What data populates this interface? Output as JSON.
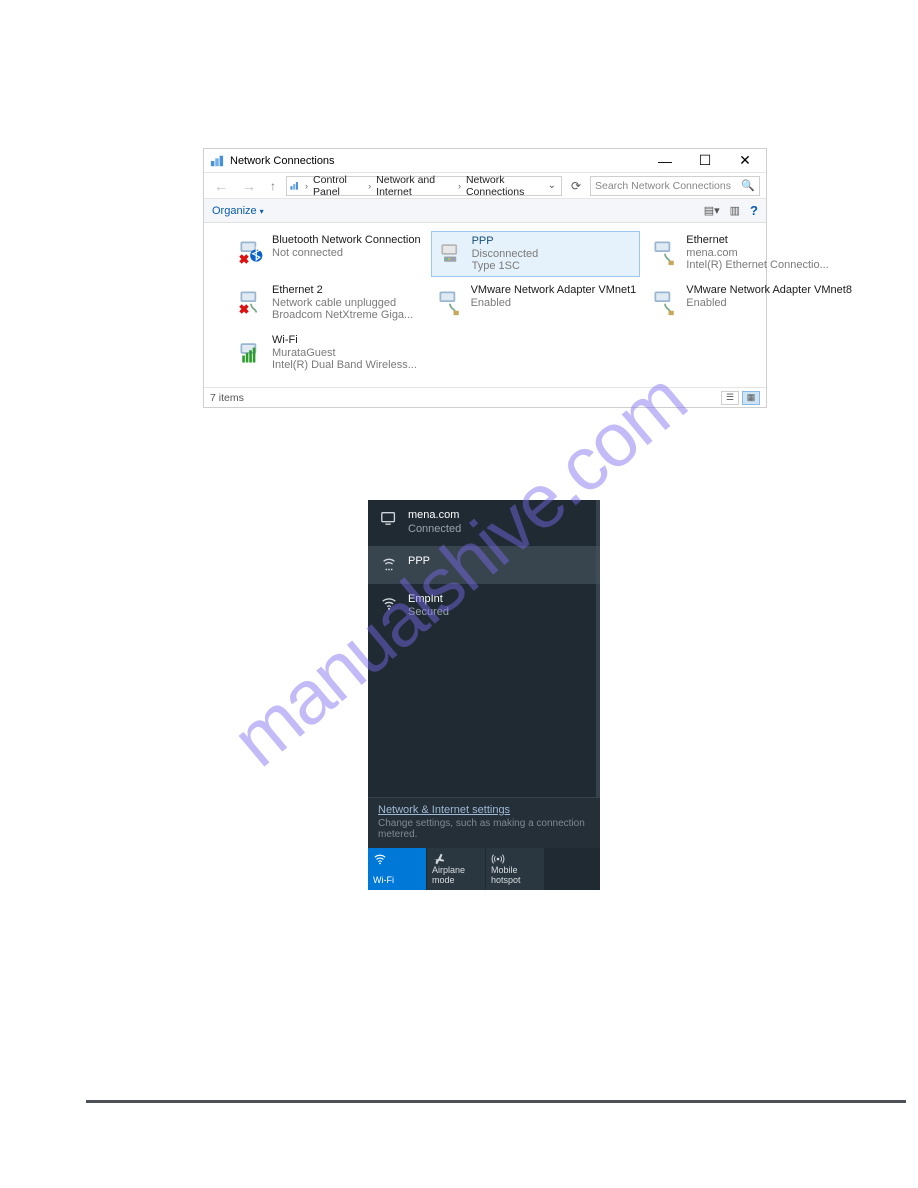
{
  "ncWindow": {
    "title": "Network Connections",
    "breadcrumb": [
      "Control Panel",
      "Network and Internet",
      "Network Connections"
    ],
    "searchPlaceholder": "Search Network Connections",
    "organizeLabel": "Organize",
    "items": [
      {
        "name": "Bluetooth Network Connection",
        "status": "Not connected",
        "device": "",
        "iconType": "bt-off"
      },
      {
        "name": "PPP",
        "status": "Disconnected",
        "device": "Type 1SC",
        "iconType": "modem",
        "selected": true
      },
      {
        "name": "Ethernet",
        "status": "mena.com",
        "device": "Intel(R) Ethernet Connectio...",
        "iconType": "eth"
      },
      {
        "name": "Ethernet 2",
        "status": "Network cable unplugged",
        "device": "Broadcom NetXtreme Giga...",
        "iconType": "eth-off"
      },
      {
        "name": "VMware Network Adapter VMnet1",
        "status": "Enabled",
        "device": "",
        "iconType": "eth"
      },
      {
        "name": "VMware Network Adapter VMnet8",
        "status": "Enabled",
        "device": "",
        "iconType": "eth"
      },
      {
        "name": "Wi-Fi",
        "status": "MurataGuest",
        "device": "Intel(R) Dual Band Wireless...",
        "iconType": "wifi"
      }
    ],
    "statusText": "7 items"
  },
  "flyout": {
    "networks": [
      {
        "name": "mena.com",
        "sub": "Connected",
        "icon": "monitor"
      },
      {
        "name": "PPP",
        "sub": "",
        "icon": "cell",
        "selected": true,
        "separator": true
      },
      {
        "name": "EmpInt",
        "sub": "Secured",
        "icon": "wifi"
      }
    ],
    "settingsLink": "Network & Internet settings",
    "settingsDesc": "Change settings, such as making a connection metered.",
    "tiles": [
      {
        "label": "Wi-Fi",
        "icon": "wifi",
        "active": true
      },
      {
        "label": "Airplane mode",
        "icon": "plane",
        "active": false
      },
      {
        "label": "Mobile hotspot",
        "icon": "hotspot",
        "active": false
      }
    ]
  },
  "watermark": "manualshive.com"
}
